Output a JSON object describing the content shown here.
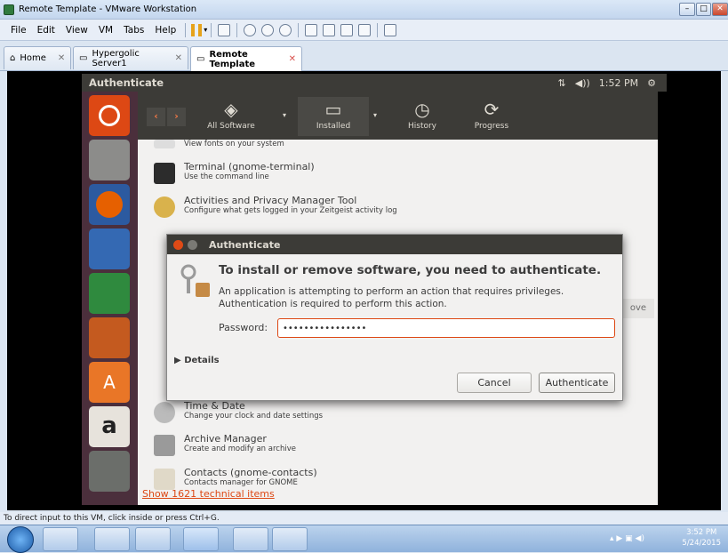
{
  "window": {
    "title": "Remote Template - VMware Workstation"
  },
  "menu": [
    "File",
    "Edit",
    "View",
    "VM",
    "Tabs",
    "Help"
  ],
  "tabs": [
    {
      "label": "Home"
    },
    {
      "label": "Hypergolic Server1"
    },
    {
      "label": "Remote Template"
    }
  ],
  "ubuntu": {
    "panel_title": "Authenticate",
    "clock": "1:52 PM",
    "toolbar": {
      "all_software": "All Software",
      "installed": "Installed",
      "history": "History",
      "progress": "Progress"
    },
    "apps": [
      {
        "name": "",
        "desc": "View fonts on your system"
      },
      {
        "name": "Terminal (gnome-terminal)",
        "desc": "Use the command line"
      },
      {
        "name": "Activities and Privacy Manager Tool",
        "desc": "Configure what gets logged in your Zeitgeist activity log"
      },
      {
        "name": "Time & Date",
        "desc": "Change your clock and date settings"
      },
      {
        "name": "Archive Manager",
        "desc": "Create and modify an archive"
      },
      {
        "name": "Contacts (gnome-contacts)",
        "desc": "Contacts manager for GNOME"
      }
    ],
    "show_technical": "Show 1621 technical items",
    "ghost_button": "ove"
  },
  "dialog": {
    "title": "Authenticate",
    "heading": "To install or remove software, you need to authenticate.",
    "body_line1": "An application is attempting to perform an action that requires privileges.",
    "body_line2": "Authentication is required to perform this action.",
    "password_label": "Password:",
    "password_value": "••••••••••••••••",
    "details": "Details",
    "cancel": "Cancel",
    "authenticate": "Authenticate"
  },
  "status_text": "To direct input to this VM, click inside or press Ctrl+G.",
  "taskbar": {
    "time": "3:52 PM",
    "date": "5/24/2015"
  },
  "colors": {
    "ubuntu_orange": "#dd4814",
    "launcher": "#4b2f3c",
    "panel": "#3c3b37"
  }
}
